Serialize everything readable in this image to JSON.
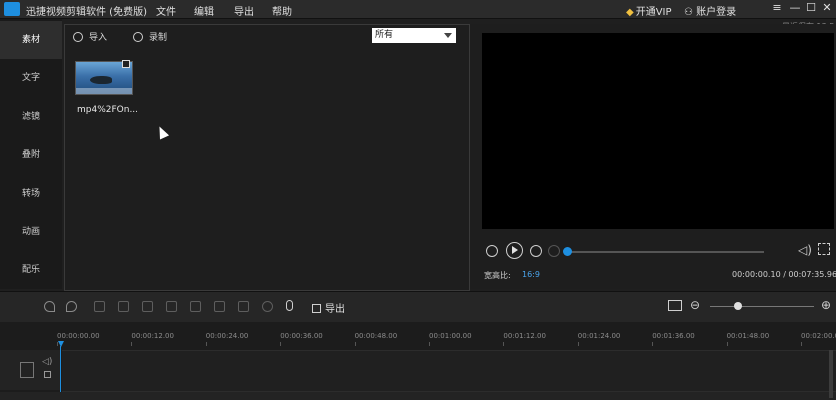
{
  "titlebar": {
    "app_title": "迅捷视频剪辑软件 (免费版)",
    "menu": [
      "文件",
      "编辑",
      "导出",
      "帮助"
    ],
    "vip_label": "开通VIP",
    "account_label": "账户登录",
    "last_saved": "最近保存 13:5"
  },
  "leftnav": {
    "items": [
      "素材",
      "文字",
      "滤镜",
      "叠附",
      "转场",
      "动画",
      "配乐"
    ],
    "active_index": 0
  },
  "media": {
    "import_label": "导入",
    "record_label": "录制",
    "filter_value": "所有",
    "clips": [
      {
        "label": "mp4%2FOn..."
      }
    ]
  },
  "preview": {
    "aspect_label": "宽高比:",
    "aspect_value": "16:9",
    "time_readout": "00:00:00.10 / 00:07:35.96",
    "progress_fraction": 0.0
  },
  "toolbar": {
    "export_label": "导出"
  },
  "timeline": {
    "ticks": [
      "00:00:00.00",
      "00:00:12.00",
      "00:00:24.00",
      "00:00:36.00",
      "00:00:48.00",
      "00:01:00.00",
      "00:01:12.00",
      "00:01:24.00",
      "00:01:36.00",
      "00:01:48.00",
      "00:02:00.00"
    ]
  },
  "colors": {
    "accent": "#1e8fe0",
    "vip": "#f0c040"
  }
}
